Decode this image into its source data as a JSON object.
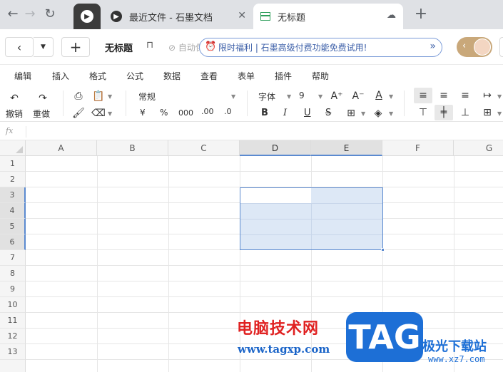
{
  "browser": {
    "tabs": [
      {
        "title": "最近文件 - 石墨文档"
      },
      {
        "title": "无标题"
      }
    ],
    "new_tab": "+"
  },
  "header": {
    "doc_title": "无标题",
    "autosave": "自动保存成功",
    "promo": "限时福利 | 石墨高级付费功能免费试用!"
  },
  "menu": [
    "编辑",
    "插入",
    "格式",
    "公式",
    "数据",
    "查看",
    "表单",
    "插件",
    "帮助"
  ],
  "toolbar": {
    "undo": "撤销",
    "redo": "重做",
    "number_format": "常规",
    "currency": "¥",
    "percent": "%",
    "thousands": "000",
    "dec_increase": ".00",
    "dec_decrease": ".0",
    "font_family": "字体",
    "font_size": "9",
    "bold": "B",
    "italic": "I",
    "underline": "U",
    "strike": "S"
  },
  "formula_bar": {
    "fx": "fx"
  },
  "grid": {
    "columns": [
      "A",
      "B",
      "C",
      "D",
      "E",
      "F",
      "G"
    ],
    "rows": [
      "1",
      "2",
      "3",
      "4",
      "5",
      "6",
      "7",
      "8",
      "9",
      "10",
      "11",
      "12",
      "13"
    ]
  },
  "watermark": {
    "site_cn": "电脑技术网",
    "site_url": "www.tagxp.com",
    "tag": "TAG",
    "brand": "极光下载站",
    "brand_url": "www.xz7.com"
  },
  "colors": {
    "selection_border": "#5b8ad0",
    "selection_fill": "#dde8f6",
    "promo_border": "#7a9bd8"
  }
}
